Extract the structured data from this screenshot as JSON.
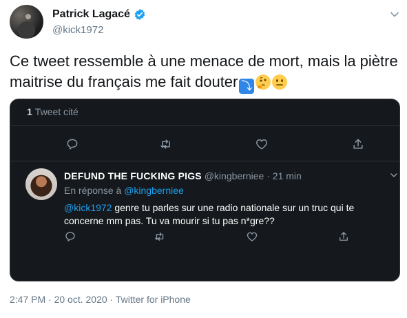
{
  "tweet": {
    "author": {
      "name": "Patrick Lagacé",
      "handle": "@kick1972"
    },
    "text": "Ce tweet ressemble à une menace de mort, mais la piètre maitrise du français me fait douter",
    "emojis": [
      "arrow-down-right-emoji",
      "thinking-face-emoji",
      "neutral-face-emoji"
    ],
    "timestamp": "2:47 PM · 20 oct. 2020",
    "separator": " · ",
    "source": "Twitter for iPhone"
  },
  "quote_card": {
    "count_number": "1",
    "count_label": "Tweet cité",
    "reply": {
      "name": "DEFUND THE FUCKING PIGS",
      "handle": "@kingberniee",
      "time": "21 min",
      "dot": "·",
      "reply_prefix": "En réponse à",
      "reply_to": "@kingberniee",
      "mention": "@kick1972",
      "body": " genre tu parles sur une radio nationale sur un truc qui te concerne mm pas. Tu va mourir si tu pas n*gre??"
    }
  },
  "colors": {
    "accent": "#1da1f2",
    "dark_bg": "#15181c",
    "muted": "#657786"
  }
}
